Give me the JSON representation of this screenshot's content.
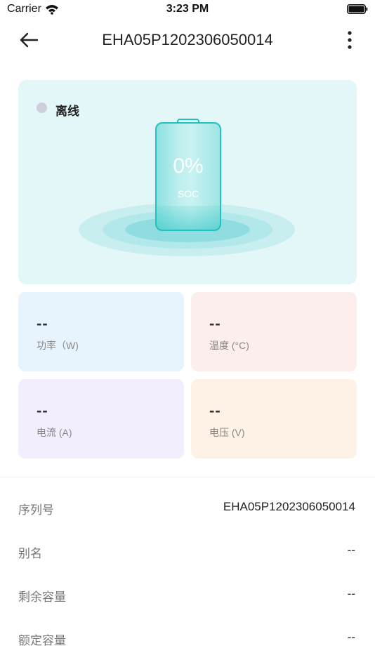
{
  "status_bar": {
    "carrier": "Carrier",
    "time": "3:23 PM"
  },
  "header": {
    "title": "EHA05P1202306050014"
  },
  "battery": {
    "status": "离线",
    "soc_value": "0%",
    "soc_label": "SOC",
    "soc_level": 0
  },
  "metrics": [
    {
      "value": "--",
      "label": "功率（W)"
    },
    {
      "value": "--",
      "label": "温度 (°C)"
    },
    {
      "value": "--",
      "label": "电流 (A)"
    },
    {
      "value": "--",
      "label": "电压 (V)"
    }
  ],
  "details": [
    {
      "key": "序列号",
      "value": "EHA05P1202306050014"
    },
    {
      "key": "别名",
      "value": "--"
    },
    {
      "key": "剩余容量",
      "value": "--"
    },
    {
      "key": "额定容量",
      "value": "--"
    }
  ],
  "colors": {
    "accent": "#20c1bf",
    "hero_bg": "#e3f6f8",
    "power_bg": "#e8f4fd",
    "temp_bg": "#fdeeee",
    "current_bg": "#f3eefd",
    "voltage_bg": "#fef1e6",
    "offline_dot": "#cfcfdc"
  }
}
